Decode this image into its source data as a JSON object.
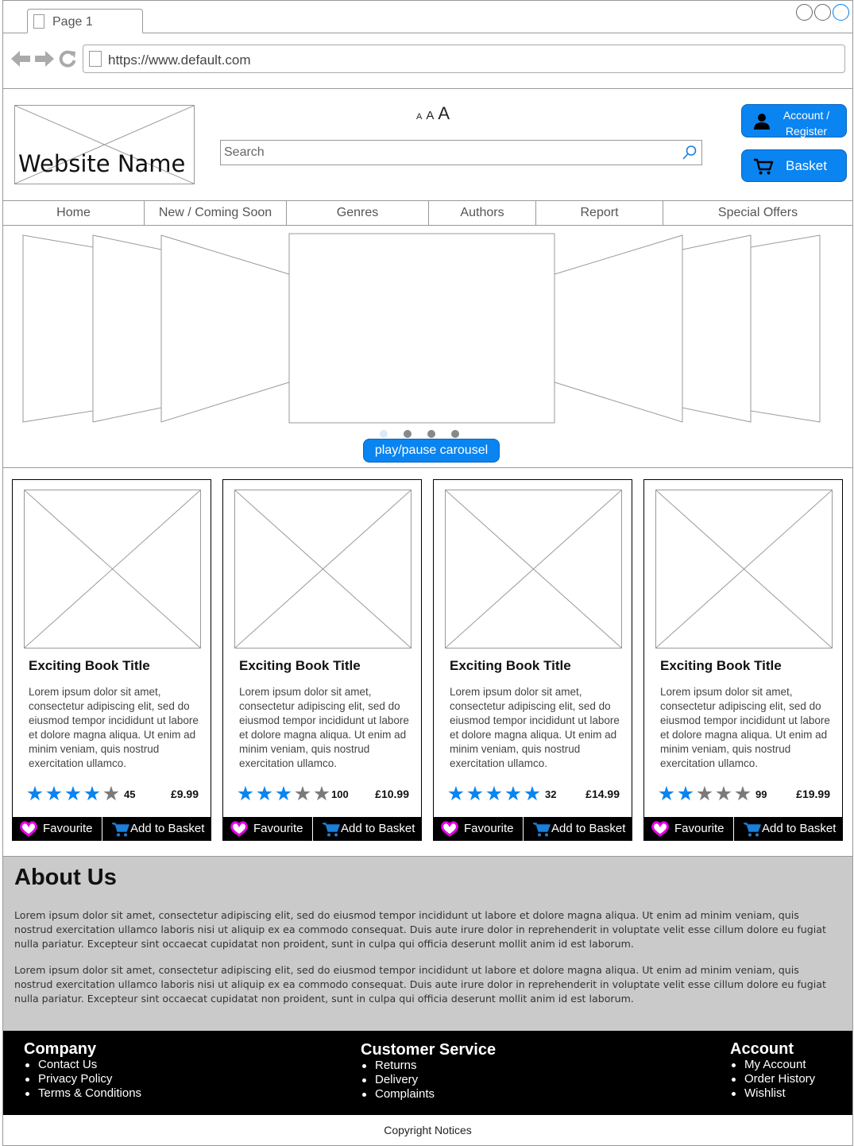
{
  "browser": {
    "tab_label": "Page 1",
    "url": "https://www.default.com"
  },
  "header": {
    "site_name": "Website Name",
    "font_size_labels": [
      "A",
      "A",
      "A"
    ],
    "search_placeholder": "Search",
    "account_button": "Account / Register",
    "basket_button": "Basket"
  },
  "nav": {
    "items": [
      "Home",
      "New / Coming Soon",
      "Genres",
      "Authors",
      "Report",
      "Special Offers"
    ]
  },
  "carousel": {
    "play_pause_label": "play/pause carousel",
    "dots": 4,
    "active_dot": 0
  },
  "products": [
    {
      "title": "Exciting Book Title",
      "description": "Lorem ipsum dolor sit amet, consectetur adipiscing elit, sed do eiusmod tempor incididunt ut labore et dolore magna aliqua. Ut enim ad minim veniam, quis nostrud exercitation ullamco.",
      "rating": 4,
      "rating_max": 5,
      "review_count": "45",
      "price": "£9.99",
      "favourite_label": "Favourite",
      "add_label": "Add to Basket"
    },
    {
      "title": "Exciting Book Title",
      "description": "Lorem ipsum dolor sit amet, consectetur adipiscing elit, sed do eiusmod tempor incididunt ut labore et dolore magna aliqua. Ut enim ad minim veniam, quis nostrud exercitation ullamco.",
      "rating": 3,
      "rating_max": 5,
      "review_count": "100",
      "price": "£10.99",
      "favourite_label": "Favourite",
      "add_label": "Add to Basket"
    },
    {
      "title": "Exciting Book Title",
      "description": "Lorem ipsum dolor sit amet, consectetur adipiscing elit, sed do eiusmod tempor incididunt ut labore et dolore magna aliqua. Ut enim ad minim veniam, quis nostrud exercitation ullamco.",
      "rating": 5,
      "rating_max": 5,
      "review_count": "32",
      "price": "£14.99",
      "favourite_label": "Favourite",
      "add_label": "Add to Basket"
    },
    {
      "title": "Exciting Book Title",
      "description": "Lorem ipsum dolor sit amet, consectetur adipiscing elit, sed do eiusmod tempor incididunt ut labore et dolore magna aliqua. Ut enim ad minim veniam, quis nostrud exercitation ullamco.",
      "rating": 2,
      "rating_max": 5,
      "review_count": "99",
      "price": "£19.99",
      "favourite_label": "Favourite",
      "add_label": "Add to Basket"
    }
  ],
  "about": {
    "heading": "About Us",
    "paragraphs": [
      "Lorem ipsum dolor sit amet, consectetur adipiscing elit, sed do eiusmod tempor incididunt ut labore et dolore magna aliqua. Ut enim ad minim veniam, quis nostrud exercitation ullamco laboris nisi ut aliquip ex ea commodo consequat. Duis aute irure dolor in reprehenderit in voluptate velit esse cillum dolore eu fugiat nulla pariatur. Excepteur sint occaecat cupidatat non proident, sunt in culpa qui officia deserunt mollit anim id est laborum.",
      "Lorem ipsum dolor sit amet, consectetur adipiscing elit, sed do eiusmod tempor incididunt ut labore et dolore magna aliqua. Ut enim ad minim veniam, quis nostrud exercitation ullamco laboris nisi ut aliquip ex ea commodo consequat. Duis aute irure dolor in reprehenderit in voluptate velit esse cillum dolore eu fugiat nulla pariatur. Excepteur sint occaecat cupidatat non proident, sunt in culpa qui officia deserunt mollit anim id est laborum."
    ]
  },
  "footer": {
    "company": {
      "heading": "Company",
      "links": [
        "Contact Us",
        "Privacy Policy",
        "Terms & Conditions"
      ]
    },
    "customer_service": {
      "heading": "Customer Service",
      "links": [
        "Returns",
        "Delivery",
        "Complaints"
      ]
    },
    "account": {
      "heading": "Account",
      "links": [
        "My Account",
        "Order History",
        "Wishlist"
      ]
    }
  },
  "copyright": "Copyright Notices",
  "colors": {
    "accent": "#0a84f0",
    "star_filled": "#0a84f0",
    "star_empty": "#7a7a7a",
    "heart": "#e600e6",
    "about_bg": "#cacaca",
    "footer_bg": "#000000"
  },
  "icons": {
    "back": "arrow-left-icon",
    "forward": "arrow-right-icon",
    "reload": "reload-icon",
    "search": "magnifier-icon",
    "account": "user-icon",
    "basket": "cart-icon",
    "favourite": "heart-icon"
  }
}
